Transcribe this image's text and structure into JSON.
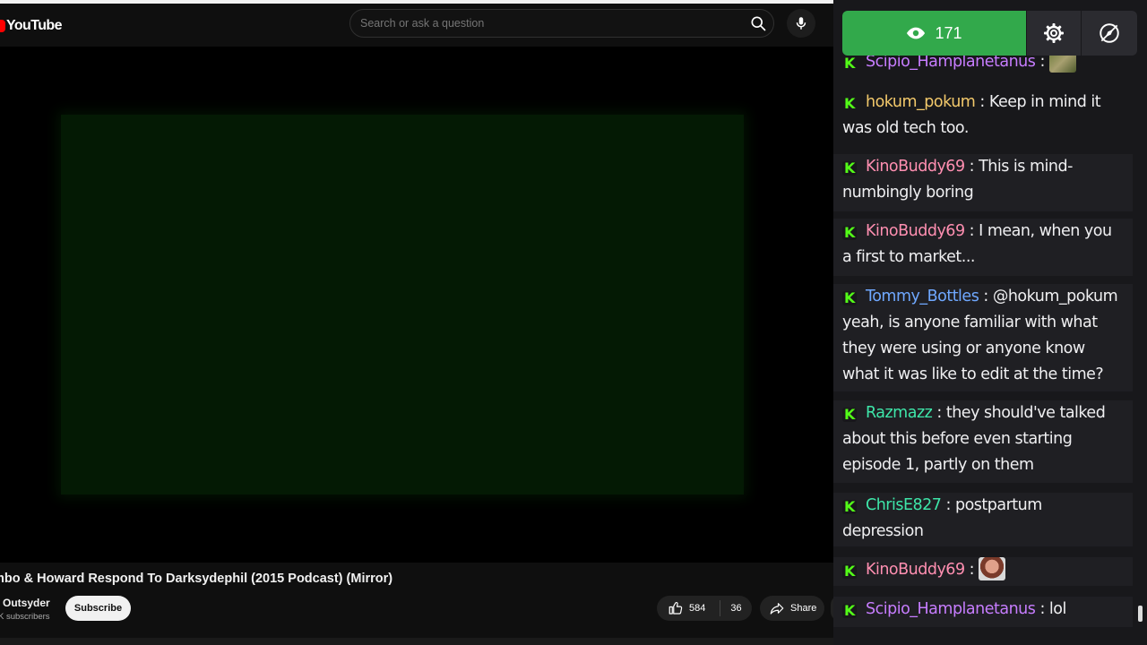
{
  "youtube": {
    "logo_text": "YouTube",
    "search_placeholder": "Search or ask a question",
    "video_title": "mbo & Howard Respond To Darksydephil (2015 Podcast) (Mirror)",
    "channel_name": "Outsyder",
    "channel_subs": "K subscribers",
    "subscribe_label": "Subscribe",
    "like_count": "584",
    "dislike_count": "36",
    "share_label": "Share",
    "colors": {
      "brand": "#ff0000",
      "video_tint": "#041a04"
    }
  },
  "chat": {
    "viewer_count": "171",
    "colors": {
      "viewer_pill": "#32a94b",
      "badge": "#53fc18"
    },
    "messages": [
      {
        "user": "Scipio_Hamplanetanus",
        "color": "#c77dff",
        "text": "",
        "emote": "moss-emote"
      },
      {
        "user": "hokum_pokum",
        "color": "#f3c96b",
        "text": "Keep in mind it was old tech too."
      },
      {
        "user": "KinoBuddy69",
        "color": "#ff8fb1",
        "text": "This is mind-numbingly boring"
      },
      {
        "user": "KinoBuddy69",
        "color": "#ff8fb1",
        "text": "I mean, when you a first to market..."
      },
      {
        "user": "Tommy_Bottles",
        "color": "#6fa8ff",
        "text": "@hokum_pokum yeah, is anyone familiar with what they were using or anyone know what it was like to edit at the time?"
      },
      {
        "user": "Razmazz",
        "color": "#3ee6a9",
        "text": "they should've talked about this before even starting episode 1, partly on them"
      },
      {
        "user": "ChrisE827",
        "color": "#3ee6a9",
        "text": "postpartum depression"
      },
      {
        "user": "KinoBuddy69",
        "color": "#ff8fb1",
        "text": "",
        "emote": "face-emote"
      },
      {
        "user": "Scipio_Hamplanetanus",
        "color": "#c77dff",
        "text": "lol"
      }
    ]
  }
}
